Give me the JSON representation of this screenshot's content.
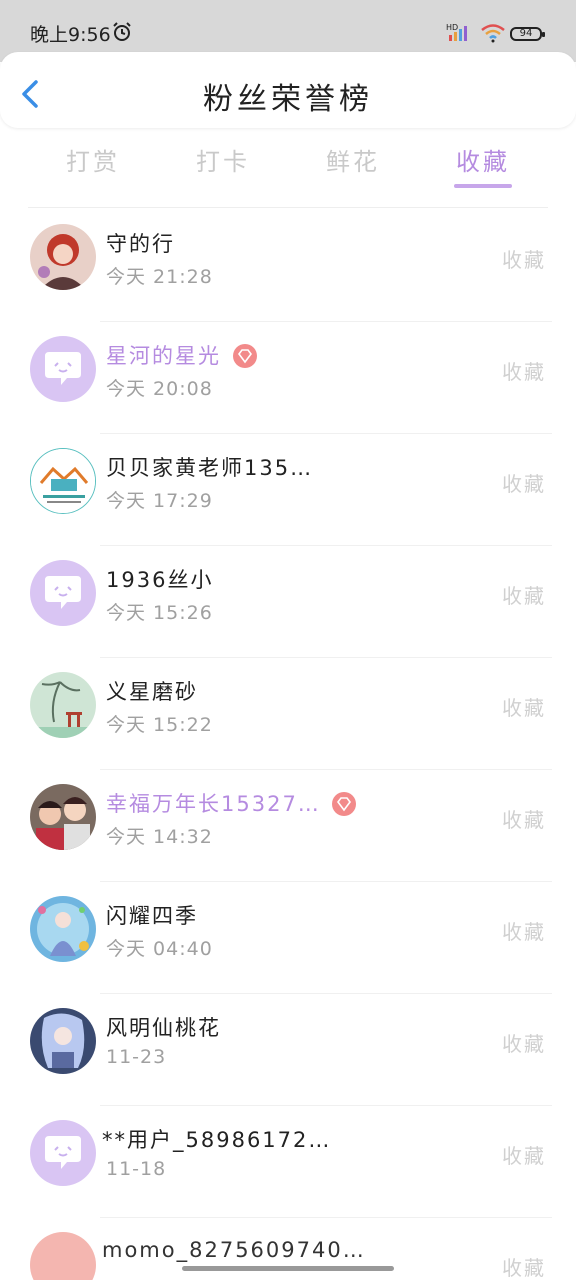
{
  "status_bar": {
    "time": "晚上9:56",
    "battery": "94",
    "icons": [
      "alarm-icon",
      "hd-signal-icon",
      "wifi-icon",
      "battery-icon"
    ]
  },
  "header": {
    "title": "粉丝荣誉榜",
    "back_icon": "chevron-left-icon"
  },
  "tabs": [
    {
      "label": "打赏",
      "active": false
    },
    {
      "label": "打卡",
      "active": false
    },
    {
      "label": "鲜花",
      "active": false
    },
    {
      "label": "收藏",
      "active": true
    }
  ],
  "colors": {
    "accent": "#b58be0",
    "avatar_default": "#d9c5f3",
    "vip_badge": "#f28a8a"
  },
  "list": [
    {
      "name": "守的行",
      "time": "今天 21:28",
      "type": "收藏",
      "avatar": "photo-avatar",
      "vip": false
    },
    {
      "name": "星河的星光",
      "time": "今天 20:08",
      "type": "收藏",
      "avatar": "default-avatar",
      "vip": true
    },
    {
      "name": "贝贝家黄老师135…",
      "time": "今天 17:29",
      "type": "收藏",
      "avatar": "logo-avatar",
      "vip": false
    },
    {
      "name": "1936丝小",
      "time": "今天 15:26",
      "type": "收藏",
      "avatar": "default-avatar",
      "vip": false
    },
    {
      "name": "义星磨砂",
      "time": "今天 15:22",
      "type": "收藏",
      "avatar": "landscape-avatar",
      "vip": false
    },
    {
      "name": "幸福万年长15327…",
      "time": "今天 14:32",
      "type": "收藏",
      "avatar": "photo-avatar",
      "vip": true
    },
    {
      "name": "闪耀四季",
      "time": "今天 04:40",
      "type": "收藏",
      "avatar": "art-avatar",
      "vip": false
    },
    {
      "name": "风明仙桃花",
      "time": "11-23",
      "type": "收藏",
      "avatar": "anime-avatar",
      "vip": false
    },
    {
      "name": "**用户_58986172…",
      "time": "11-18",
      "type": "收藏",
      "avatar": "default-avatar",
      "vip": false
    },
    {
      "name": "momo_8275609740…",
      "time": "",
      "type": "收藏",
      "avatar": "photo-avatar",
      "vip": false
    }
  ]
}
